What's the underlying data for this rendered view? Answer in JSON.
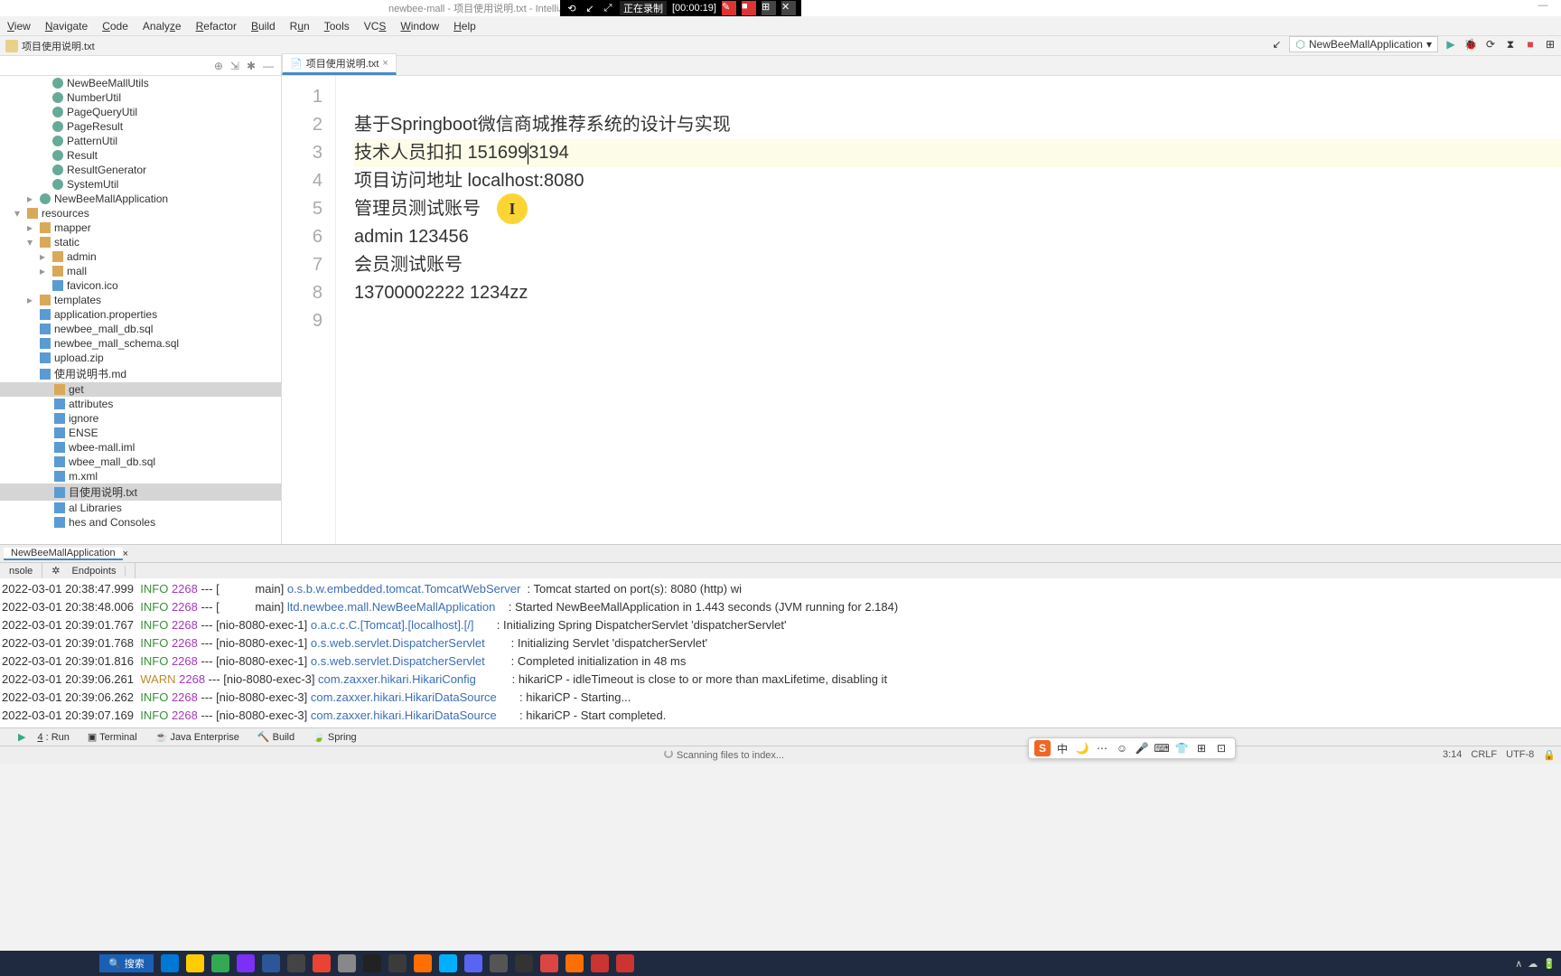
{
  "recording": {
    "label": "正在录制",
    "time": "[00:00:19]"
  },
  "window_title": "newbee-mall - 项目使用说明.txt - IntelliJ...",
  "menu": [
    "View",
    "Navigate",
    "Code",
    "Analyze",
    "Refactor",
    "Build",
    "Run",
    "Tools",
    "VCS",
    "Window",
    "Help"
  ],
  "breadcrumb": "项目使用说明.txt",
  "run_config": "NewBeeMallApplication",
  "tree": {
    "items": [
      {
        "d": 3,
        "k": "c",
        "t": "NewBeeMallUtils"
      },
      {
        "d": 3,
        "k": "c",
        "t": "NumberUtil"
      },
      {
        "d": 3,
        "k": "c",
        "t": "PageQueryUtil"
      },
      {
        "d": 3,
        "k": "c",
        "t": "PageResult"
      },
      {
        "d": 3,
        "k": "c",
        "t": "PatternUtil"
      },
      {
        "d": 3,
        "k": "c",
        "t": "Result"
      },
      {
        "d": 3,
        "k": "c",
        "t": "ResultGenerator"
      },
      {
        "d": 3,
        "k": "c",
        "t": "SystemUtil"
      },
      {
        "d": 2,
        "k": "c",
        "t": "NewBeeMallApplication",
        "ar": "▸"
      },
      {
        "d": 1,
        "k": "f",
        "t": "resources",
        "ar": "▾"
      },
      {
        "d": 2,
        "k": "f",
        "t": "mapper",
        "ar": "▸"
      },
      {
        "d": 2,
        "k": "f",
        "t": "static",
        "ar": "▾"
      },
      {
        "d": 3,
        "k": "f",
        "t": "admin",
        "ar": "▸"
      },
      {
        "d": 3,
        "k": "f",
        "t": "mall",
        "ar": "▸"
      },
      {
        "d": 3,
        "k": "x",
        "t": "favicon.ico"
      },
      {
        "d": 2,
        "k": "f",
        "t": "templates",
        "ar": "▸"
      },
      {
        "d": 2,
        "k": "x",
        "t": "application.properties"
      },
      {
        "d": 2,
        "k": "x",
        "t": "newbee_mall_db.sql"
      },
      {
        "d": 2,
        "k": "x",
        "t": "newbee_mall_schema.sql"
      },
      {
        "d": 2,
        "k": "x",
        "t": "upload.zip"
      },
      {
        "d": 2,
        "k": "x",
        "t": "使用说明书.md"
      },
      {
        "d": 0,
        "k": "f",
        "t": "get",
        "sel": true
      },
      {
        "d": 0,
        "k": "x",
        "t": "attributes"
      },
      {
        "d": 0,
        "k": "x",
        "t": "ignore"
      },
      {
        "d": 0,
        "k": "x",
        "t": "ENSE"
      },
      {
        "d": 0,
        "k": "x",
        "t": "wbee-mall.iml"
      },
      {
        "d": 0,
        "k": "x",
        "t": "wbee_mall_db.sql"
      },
      {
        "d": 0,
        "k": "x",
        "t": "m.xml"
      },
      {
        "d": 0,
        "k": "x",
        "t": "目使用说明.txt",
        "sel": true
      },
      {
        "d": 0,
        "k": "x",
        "t": "al Libraries"
      },
      {
        "d": 0,
        "k": "x",
        "t": "hes and Consoles"
      }
    ]
  },
  "editor": {
    "tab": "项目使用说明.txt",
    "lines": [
      "",
      "基于Springboot微信商城推荐系统的设计与实现",
      "技术人员扣扣 1516993194",
      "项目访问地址 localhost:8080",
      "管理员测试账号",
      "admin 123456",
      "会员测试账号",
      "13700002222 1234zz",
      ""
    ],
    "highlight_line": 3
  },
  "run_tabs": {
    "app": "NewBeeMallApplication",
    "sub": [
      "nsole",
      "Endpoints"
    ]
  },
  "console": [
    {
      "ts": "2022-03-01 20:38:47.999",
      "lv": "INFO",
      "pid": "2268",
      "th": "[           main]",
      "cl": "o.s.b.w.embedded.tomcat.TomcatWebServer",
      "msg": ": Tomcat started on port(s): 8080 (http) wi"
    },
    {
      "ts": "2022-03-01 20:38:48.006",
      "lv": "INFO",
      "pid": "2268",
      "th": "[           main]",
      "cl": "ltd.newbee.mall.NewBeeMallApplication",
      "msg": ": Started NewBeeMallApplication in 1.443 seconds (JVM running for 2.184)"
    },
    {
      "ts": "2022-03-01 20:39:01.767",
      "lv": "INFO",
      "pid": "2268",
      "th": "[nio-8080-exec-1]",
      "cl": "o.a.c.c.C.[Tomcat].[localhost].[/]",
      "msg": ": Initializing Spring DispatcherServlet 'dispatcherServlet'"
    },
    {
      "ts": "2022-03-01 20:39:01.768",
      "lv": "INFO",
      "pid": "2268",
      "th": "[nio-8080-exec-1]",
      "cl": "o.s.web.servlet.DispatcherServlet",
      "msg": ": Initializing Servlet 'dispatcherServlet'"
    },
    {
      "ts": "2022-03-01 20:39:01.816",
      "lv": "INFO",
      "pid": "2268",
      "th": "[nio-8080-exec-1]",
      "cl": "o.s.web.servlet.DispatcherServlet",
      "msg": ": Completed initialization in 48 ms"
    },
    {
      "ts": "2022-03-01 20:39:06.261",
      "lv": "WARN",
      "pid": "2268",
      "th": "[nio-8080-exec-3]",
      "cl": "com.zaxxer.hikari.HikariConfig",
      "msg": ": hikariCP - idleTimeout is close to or more than maxLifetime, disabling it"
    },
    {
      "ts": "2022-03-01 20:39:06.262",
      "lv": "INFO",
      "pid": "2268",
      "th": "[nio-8080-exec-3]",
      "cl": "com.zaxxer.hikari.HikariDataSource",
      "msg": ": hikariCP - Starting..."
    },
    {
      "ts": "2022-03-01 20:39:07.169",
      "lv": "INFO",
      "pid": "2268",
      "th": "[nio-8080-exec-3]",
      "cl": "com.zaxxer.hikari.HikariDataSource",
      "msg": ": hikariCP - Start completed."
    }
  ],
  "bottom_tools": [
    "4: Run",
    "Terminal",
    "Java Enterprise",
    "Build",
    "Spring"
  ],
  "status": {
    "msg": "Scanning files to index...",
    "pos": "3:14",
    "eol": "CRLF",
    "enc": "UTF-8"
  },
  "taskbar": {
    "search": "搜索"
  },
  "ime": [
    "S",
    "中",
    "🌙",
    "⋯",
    "☺",
    "🎤",
    "⌨",
    "👕",
    "⊞",
    "⊡"
  ]
}
